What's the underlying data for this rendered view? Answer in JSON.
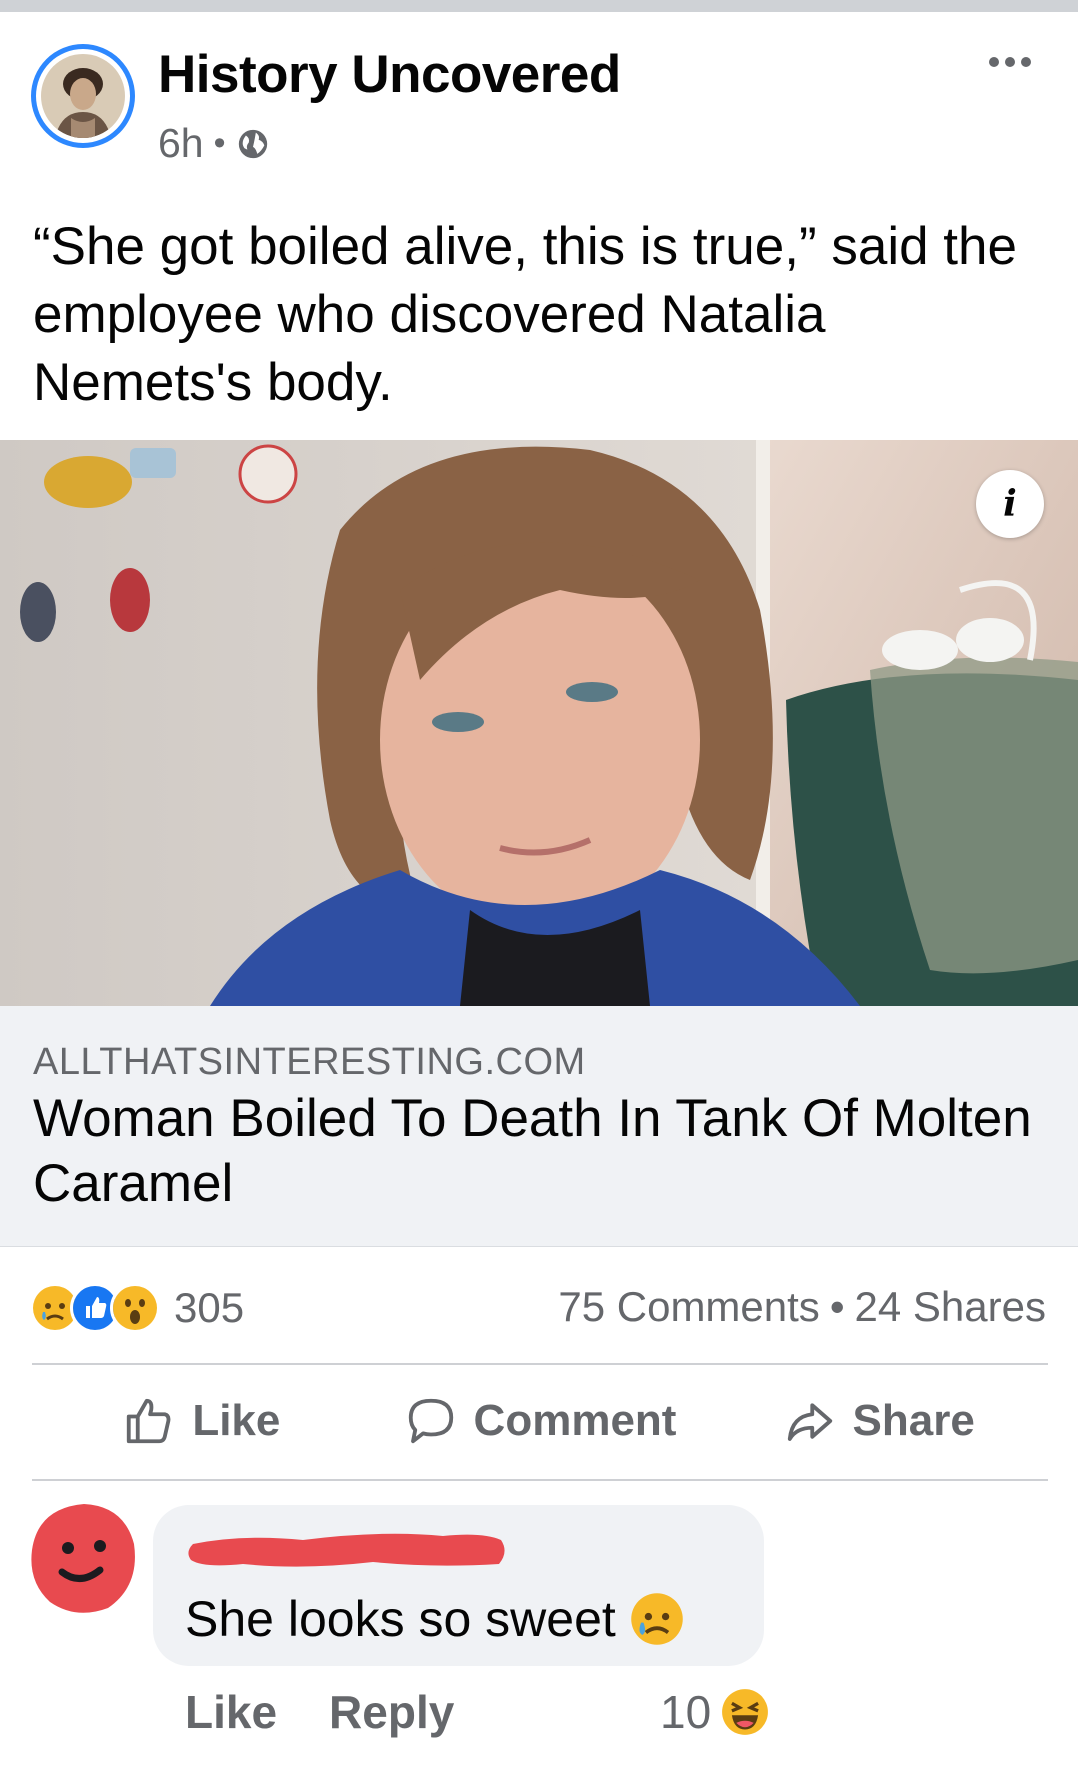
{
  "post": {
    "page_name": "History Uncovered",
    "time": "6h",
    "separator": "•",
    "caption": "“She got boiled alive, this is true,” said the employee who discovered Natalia Nemets's body."
  },
  "link": {
    "domain": "ALLTHATSINTERESTING.COM",
    "title": "Woman Boiled To Death In Tank Of Molten Caramel",
    "info_label": "i"
  },
  "engagement": {
    "reaction_icons": [
      "sad-reaction-icon",
      "like-reaction-icon",
      "wow-reaction-icon"
    ],
    "reaction_count": "305",
    "comments": "75 Comments",
    "separator": "•",
    "shares": "24 Shares"
  },
  "actions": {
    "like": "Like",
    "comment": "Comment",
    "share": "Share"
  },
  "comment": {
    "text": "She looks so sweet",
    "like": "Like",
    "reply": "Reply",
    "reaction_count": "10"
  },
  "colors": {
    "accent_blue": "#2d88ff",
    "muted_text": "#65676b",
    "link_box_bg": "#f0f2f5",
    "redaction_red": "#e84a4f"
  }
}
